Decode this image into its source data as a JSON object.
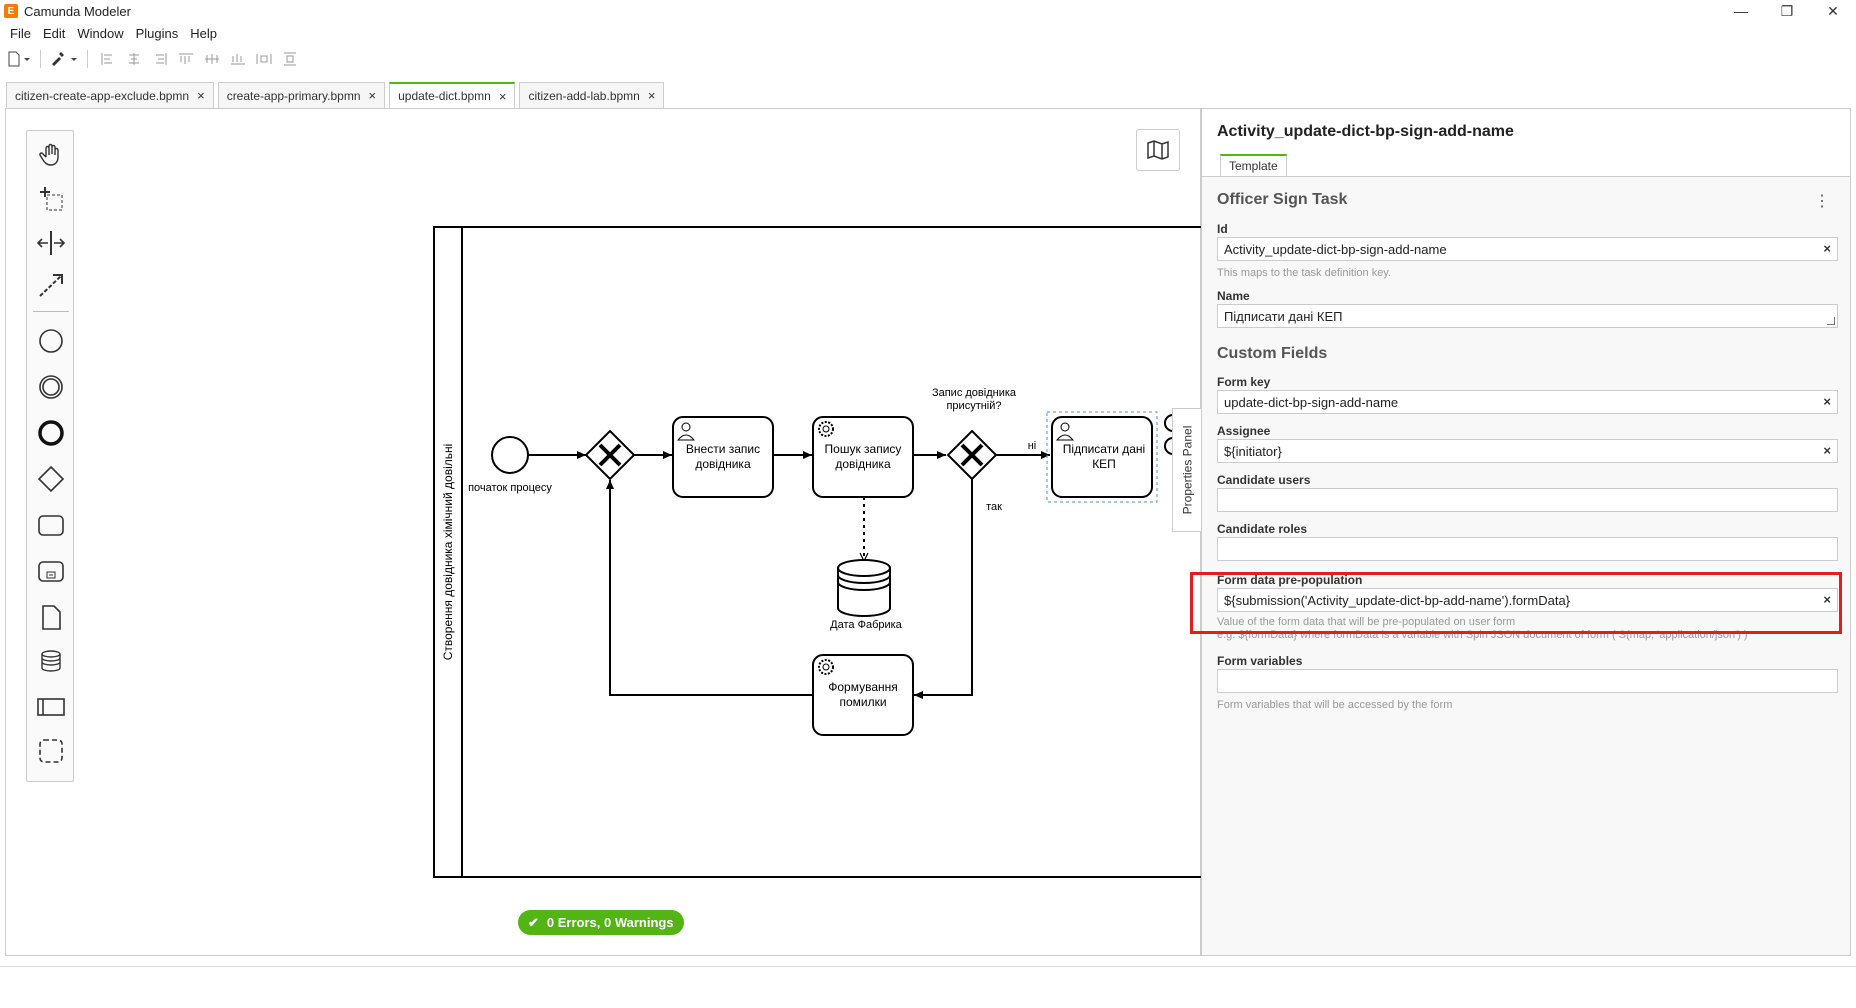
{
  "window": {
    "title": "Camunda Modeler",
    "minimize_glyph": "—",
    "maximize_glyph": "❐",
    "close_glyph": "✕",
    "logo_glyph": "E"
  },
  "menu": [
    "File",
    "Edit",
    "Window",
    "Plugins",
    "Help"
  ],
  "tabs": [
    {
      "label": "citizen-create-app-exclude.bpmn",
      "active": false
    },
    {
      "label": "create-app-primary.bpmn",
      "active": false
    },
    {
      "label": "update-dict.bpmn",
      "active": true
    },
    {
      "label": "citizen-add-lab.bpmn",
      "active": false
    }
  ],
  "tab_close_glyph": "×",
  "diagram": {
    "lane_label": "Створення довідника хімічний довільні",
    "start_event_label": "початок процесу",
    "task_enter_line1": "Внести запис",
    "task_enter_line2": "довідника",
    "task_search_line1": "Пошук запису",
    "task_search_line2": "довідника",
    "datastore_label": "Дата Фабрика",
    "gateway_question_line1": "Запис довідника",
    "gateway_question_line2": "присутній?",
    "flow_no": "ні",
    "flow_yes": "так",
    "task_sign_line1": "Підписати дані",
    "task_sign_line2": "КЕП",
    "task_error_line1": "Формування",
    "task_error_line2": "помилки"
  },
  "status": {
    "check_glyph": "✔",
    "text": "0 Errors, 0 Warnings",
    "color": "#52b415"
  },
  "properties_toggle": "Properties Panel",
  "properties": {
    "element_id_title": "Activity_update-dict-bp-sign-add-name",
    "tab": "Template",
    "template_name": "Officer Sign Task",
    "menu_glyph": "⋮",
    "clear_glyph": "×",
    "id_label": "Id",
    "id_value": "Activity_update-dict-bp-sign-add-name",
    "id_desc": "This maps to the task definition key.",
    "name_label": "Name",
    "name_value": "Підписати дані КЕП",
    "custom_fields_title": "Custom Fields",
    "form_key_label": "Form key",
    "form_key_value": "update-dict-bp-sign-add-name",
    "assignee_label": "Assignee",
    "assignee_value": "${initiator}",
    "candidate_users_label": "Candidate users",
    "candidate_users_value": "",
    "candidate_roles_label": "Candidate roles",
    "candidate_roles_value": "",
    "form_data_label": "Form data pre-population",
    "form_data_value": "${submission('Activity_update-dict-bp-add-name').formData}",
    "form_data_desc1": "Value of the form data that will be pre-populated on user form",
    "form_data_desc2": "e.g. ${formData} where formData is a variable with Spin JSON document of form ( S(map, 'application/json') )",
    "form_variables_label": "Form variables",
    "form_variables_value": "",
    "form_variables_desc": "Form variables that will be accessed by the form"
  },
  "colors": {
    "accent": "#52b415",
    "highlight": "#e01f1f",
    "app_logo": "#f57c00"
  }
}
